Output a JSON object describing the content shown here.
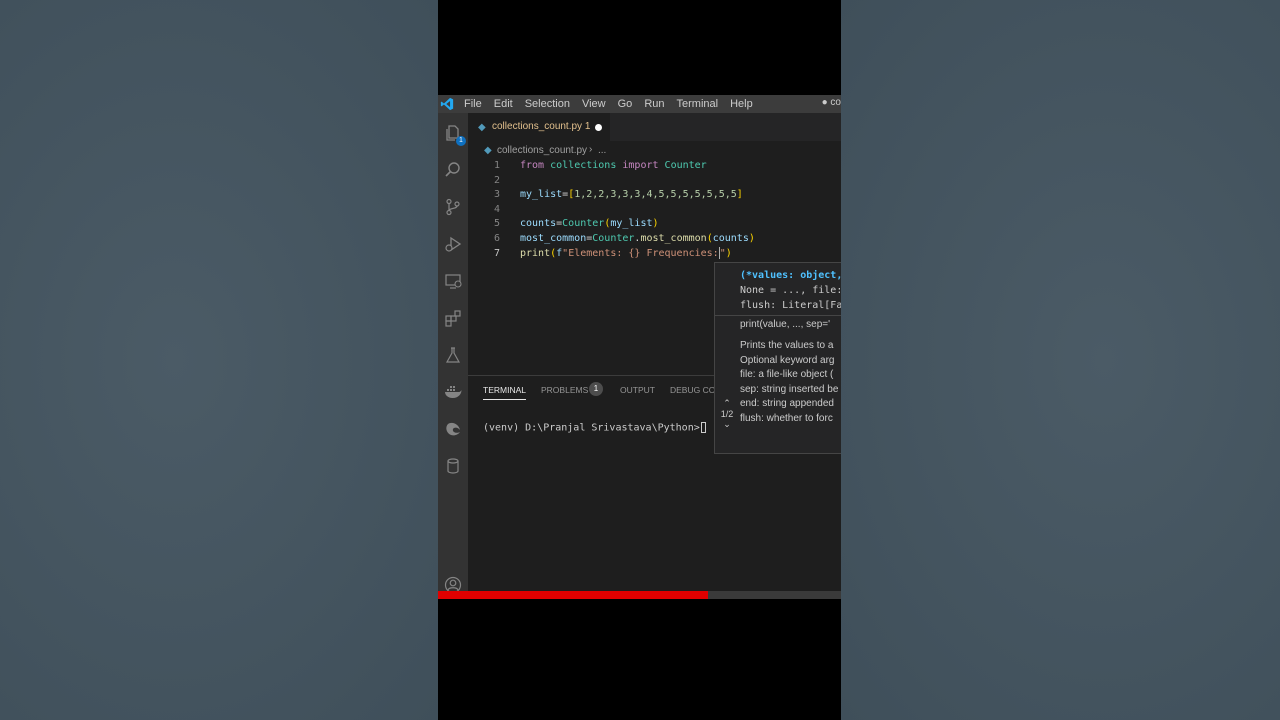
{
  "window": {
    "menu": [
      "File",
      "Edit",
      "Selection",
      "View",
      "Go",
      "Run",
      "Terminal",
      "Help"
    ],
    "title_fragment": "● co"
  },
  "activity_bar": {
    "icons": [
      "files-icon",
      "search-icon",
      "source-control-icon",
      "run-debug-icon",
      "remote-explorer-icon",
      "extensions-icon",
      "testing-icon",
      "docker-icon",
      "edge-devtools-icon",
      "database-icon",
      "account-icon"
    ],
    "explorer_badge": "1"
  },
  "tab": {
    "label": "collections_count.py",
    "problems_count": "1"
  },
  "breadcrumb": {
    "file": "collections_count.py",
    "more": "..."
  },
  "line_numbers": [
    "1",
    "2",
    "3",
    "4",
    "5",
    "6",
    "7"
  ],
  "code": {
    "l1": {
      "from": "from",
      "module": "collections",
      "import": "import",
      "cls": "Counter"
    },
    "l3": {
      "var": "my_list",
      "eq": "=",
      "open": "[",
      "nums": "1,2,2,3,3,3,4,5,5,5,5,5,5,5",
      "close": "]"
    },
    "l5": {
      "var": "counts",
      "eq": "=",
      "cls": "Counter",
      "open": "(",
      "arg": "my_list",
      "close": ")"
    },
    "l6": {
      "var": "most_common",
      "eq": "=",
      "cls": "Counter",
      "dot": ".",
      "fn": "most_common",
      "open": "(",
      "arg": "counts",
      "close": ")"
    },
    "l7": {
      "fn": "print",
      "open": "(",
      "f": "f",
      "str": "\"Elements: {} Frequencies:",
      "quote": "\"",
      "close": ")"
    }
  },
  "panel": {
    "tabs": [
      "TERMINAL",
      "PROBLEMS",
      "OUTPUT",
      "DEBUG CON"
    ],
    "problems_badge": "1",
    "terminal_prompt": "(venv) D:\\Pranjal Srivastava\\Python>"
  },
  "hover": {
    "sig1_bold": "(*values: object,",
    "sig2": "None = ..., file:",
    "sig3": "flush: Literal[Fa",
    "usage": "print(value, ..., sep='",
    "doc1": "Prints the values to a",
    "doc2": "Optional keyword arg",
    "doc3": "file: a file-like object (",
    "doc4": "sep: string inserted be",
    "doc5": "end: string appended",
    "doc6": "flush: whether to forc",
    "overload": "1/2"
  },
  "video_progress": 0.67,
  "colors": {
    "accent": "#007acc",
    "progress": "#e00000",
    "keyword": "#c586c0",
    "class": "#4ec9b0",
    "variable": "#9cdcfe",
    "function": "#dcdcaa",
    "number": "#b5cea8",
    "string": "#ce9178"
  }
}
